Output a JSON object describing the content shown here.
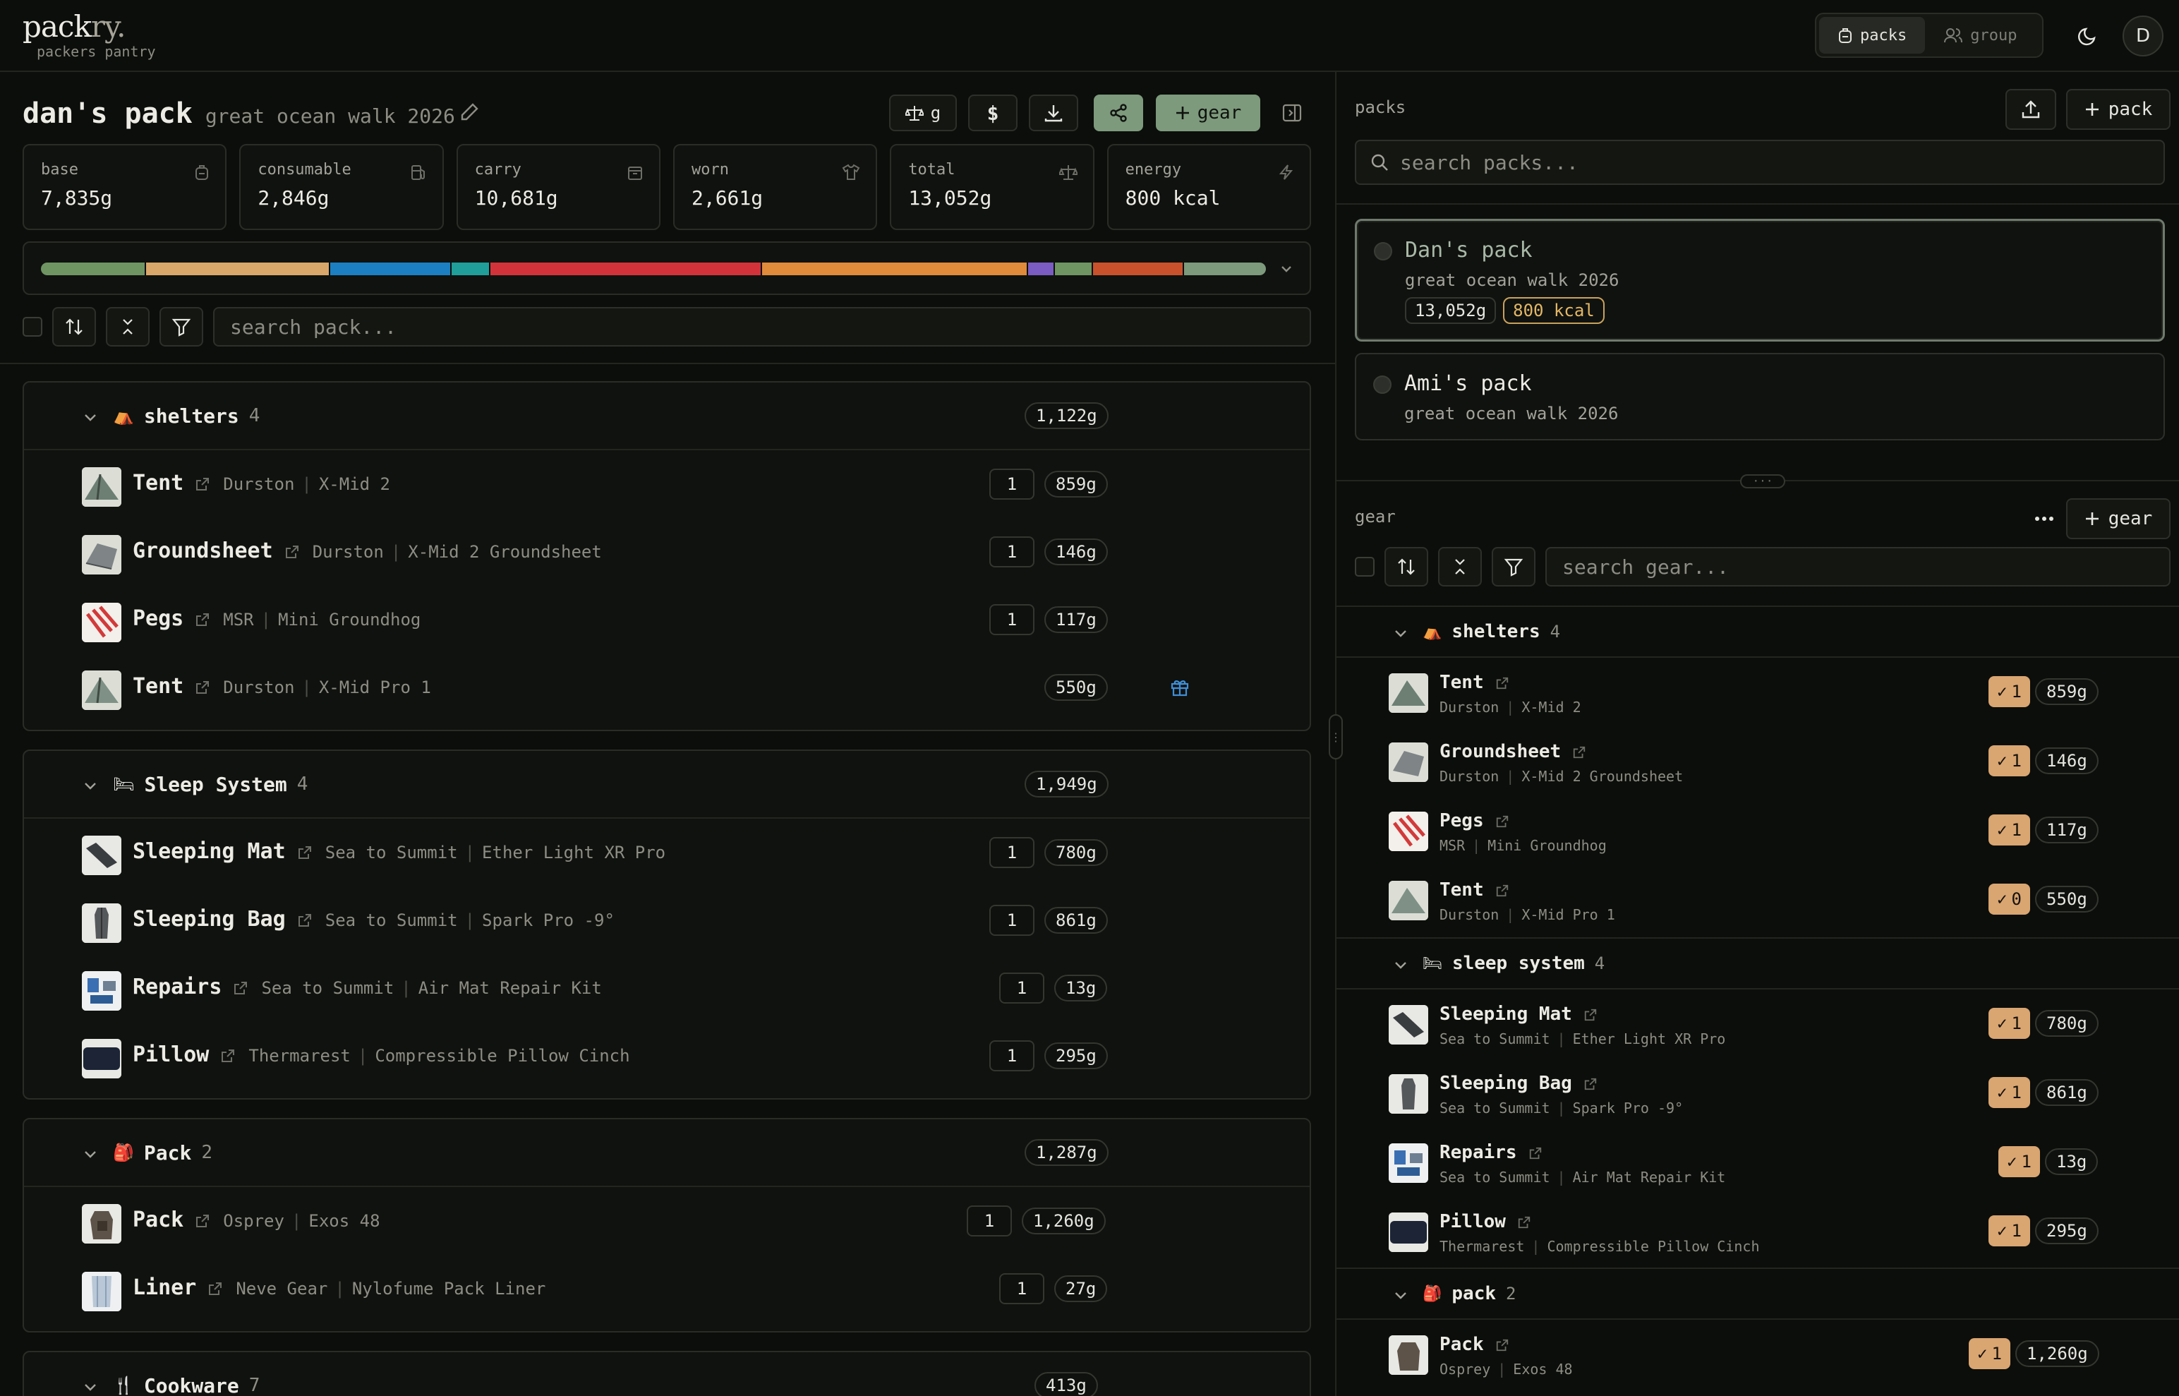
{
  "brand": {
    "name_main": "pack",
    "name_accent": "ry.",
    "tagline": "packers pantry"
  },
  "nav": {
    "tabs": [
      {
        "label": "packs"
      },
      {
        "label": "group"
      }
    ],
    "avatar": "D"
  },
  "pack": {
    "title": "dan's pack",
    "subtitle": "great ocean walk 2026",
    "toolbar": {
      "unit_label": "g",
      "currency_label": "$",
      "add_gear_label": "gear"
    },
    "stats": [
      {
        "label": "base",
        "value": "7,835g",
        "icon": "backpack-icon"
      },
      {
        "label": "consumable",
        "value": "2,846g",
        "icon": "fuel-icon"
      },
      {
        "label": "carry",
        "value": "10,681g",
        "icon": "bag-icon"
      },
      {
        "label": "worn",
        "value": "2,661g",
        "icon": "shirt-icon"
      },
      {
        "label": "total",
        "value": "13,052g",
        "icon": "scale-icon"
      },
      {
        "label": "energy",
        "value": "800 kcal",
        "icon": "bolt-icon"
      }
    ],
    "distribution": [
      {
        "share": 8.6,
        "color": "#6f9563"
      },
      {
        "share": 15.0,
        "color": "#d9a76a"
      },
      {
        "share": 9.9,
        "color": "#1c7fc2"
      },
      {
        "share": 3.2,
        "color": "#1f9e9a"
      },
      {
        "share": 22.2,
        "color": "#d2333a"
      },
      {
        "share": 21.7,
        "color": "#e08a3c"
      },
      {
        "share": 2.2,
        "color": "#7a5cc2"
      },
      {
        "share": 3.1,
        "color": "#6f9563"
      },
      {
        "share": 7.4,
        "color": "#c9522c"
      },
      {
        "share": 6.7,
        "color": "#7d9a7c"
      }
    ],
    "search_placeholder": "search pack...",
    "categories": [
      {
        "name": "shelters",
        "emoji": "⛺",
        "count": "4",
        "weight": "1,122g",
        "items": [
          {
            "name": "Tent",
            "brand": "Durston",
            "model": "X-Mid 2",
            "qty": "1",
            "weight": "859g"
          },
          {
            "name": "Groundsheet",
            "brand": "Durston",
            "model": "X-Mid 2 Groundsheet",
            "qty": "1",
            "weight": "146g"
          },
          {
            "name": "Pegs",
            "brand": "MSR",
            "model": "Mini Groundhog",
            "qty": "1",
            "weight": "117g"
          },
          {
            "name": "Tent",
            "brand": "Durston",
            "model": "X-Mid Pro 1",
            "qty": "",
            "weight": "550g",
            "gift": true
          }
        ]
      },
      {
        "name": "Sleep System",
        "emoji": "🛏",
        "count": "4",
        "weight": "1,949g",
        "items": [
          {
            "name": "Sleeping Mat",
            "brand": "Sea to Summit",
            "model": "Ether Light XR Pro",
            "qty": "1",
            "weight": "780g"
          },
          {
            "name": "Sleeping Bag",
            "brand": "Sea to Summit",
            "model": "Spark Pro -9°",
            "qty": "1",
            "weight": "861g"
          },
          {
            "name": "Repairs",
            "brand": "Sea to Summit",
            "model": "Air Mat Repair Kit",
            "qty": "1",
            "weight": "13g"
          },
          {
            "name": "Pillow",
            "brand": "Thermarest",
            "model": "Compressible Pillow Cinch",
            "qty": "1",
            "weight": "295g"
          }
        ]
      },
      {
        "name": "Pack",
        "emoji": "🎒",
        "count": "2",
        "weight": "1,287g",
        "items": [
          {
            "name": "Pack",
            "brand": "Osprey",
            "model": "Exos 48",
            "qty": "1",
            "weight": "1,260g"
          },
          {
            "name": "Liner",
            "brand": "Neve Gear",
            "model": "Nylofume Pack Liner",
            "qty": "1",
            "weight": "27g"
          }
        ]
      },
      {
        "name": "Cookware",
        "emoji": "🍴",
        "count": "7",
        "weight": "413g",
        "items": []
      }
    ]
  },
  "packs_panel": {
    "title": "packs",
    "add_label": "pack",
    "search_placeholder": "search packs...",
    "packs": [
      {
        "name": "Dan's pack",
        "subtitle": "great ocean walk 2026",
        "weight": "13,052g",
        "energy": "800 kcal",
        "selected": true
      },
      {
        "name": "Ami's pack",
        "subtitle": "great ocean walk 2026"
      }
    ]
  },
  "gear_panel": {
    "title": "gear",
    "add_label": "gear",
    "search_placeholder": "search gear...",
    "categories": [
      {
        "name": "shelters",
        "emoji": "⛺",
        "count": "4",
        "items": [
          {
            "name": "Tent",
            "brand": "Durston",
            "model": "X-Mid 2",
            "qty": "1",
            "weight": "859g"
          },
          {
            "name": "Groundsheet",
            "brand": "Durston",
            "model": "X-Mid 2 Groundsheet",
            "qty": "1",
            "weight": "146g"
          },
          {
            "name": "Pegs",
            "brand": "MSR",
            "model": "Mini Groundhog",
            "qty": "1",
            "weight": "117g"
          },
          {
            "name": "Tent",
            "brand": "Durston",
            "model": "X-Mid Pro 1",
            "qty": "0",
            "weight": "550g"
          }
        ]
      },
      {
        "name": "sleep system",
        "emoji": "🛏",
        "count": "4",
        "items": [
          {
            "name": "Sleeping Mat",
            "brand": "Sea to Summit",
            "model": "Ether Light XR Pro",
            "qty": "1",
            "weight": "780g"
          },
          {
            "name": "Sleeping Bag",
            "brand": "Sea to Summit",
            "model": "Spark Pro -9°",
            "qty": "1",
            "weight": "861g"
          },
          {
            "name": "Repairs",
            "brand": "Sea to Summit",
            "model": "Air Mat Repair Kit",
            "qty": "1",
            "weight": "13g"
          },
          {
            "name": "Pillow",
            "brand": "Thermarest",
            "model": "Compressible Pillow Cinch",
            "qty": "1",
            "weight": "295g"
          }
        ]
      },
      {
        "name": "pack",
        "emoji": "🎒",
        "count": "2",
        "items": [
          {
            "name": "Pack",
            "brand": "Osprey",
            "model": "Exos 48",
            "qty": "1",
            "weight": "1,260g"
          }
        ]
      }
    ]
  }
}
